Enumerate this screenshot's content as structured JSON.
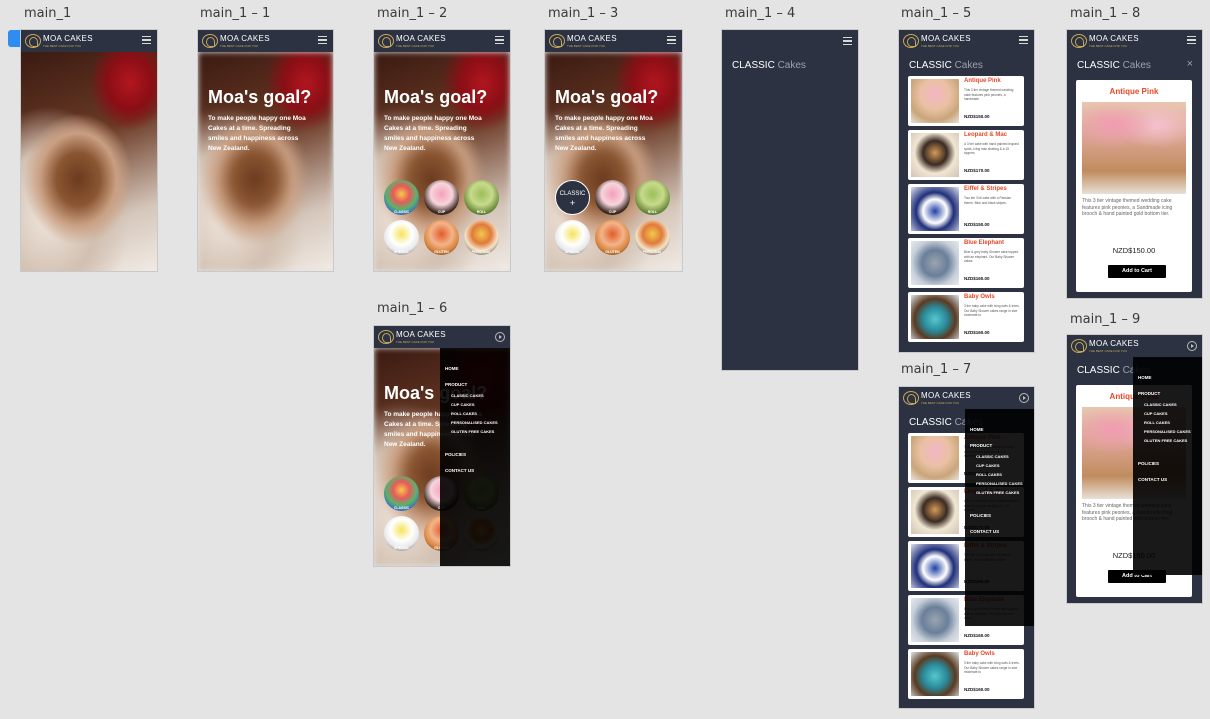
{
  "artboards": {
    "a1": "main_1",
    "a2": "main_1 – 1",
    "a3": "main_1 – 2",
    "a4": "main_1 – 3",
    "a5": "main_1 – 4",
    "a6": "main_1 – 5",
    "a7": "main_1 – 8",
    "a8": "main_1 – 6",
    "a9": "main_1 – 7",
    "a10": "main_1 – 9"
  },
  "brand": {
    "name": "MOA CAKES",
    "tagline": "THE BEST CAKE FOR YOU"
  },
  "hero": {
    "title": "Moa's goal?",
    "text": "To make people happy one Moa Cakes at a time. Spreading smiles and happiness across New Zealand."
  },
  "categories": {
    "c1": "CLASSIC",
    "c2": "CUP",
    "c3": "ROLL",
    "c4": "SPECIAL",
    "c5": "GLUTEN",
    "c6": "PERSONAL",
    "selected_label": "CLASSIC",
    "selected_icon": "+"
  },
  "classic": {
    "title_a": "CLASSIC",
    "title_b": "Cakes"
  },
  "products": [
    {
      "name": "Antique Pink",
      "desc": "This 3 tier vintage themed wedding cake features pink peonies, a handmade",
      "price": "NZD$150.00"
    },
    {
      "name": "Leopard & Mac",
      "desc": "A 3 tier cake with hand painted leopard spots, Icing mac shaking & a 15 toppers",
      "price": "NZD$170.00"
    },
    {
      "name": "Eiffel & Stripes",
      "desc": "Two tier 3'x6 cake with a Parisian theme. Blue and black stripes.",
      "price": "NZD$150.00"
    },
    {
      "name": "Blue Elephant",
      "desc": "Blue & grey baby Shower cake topped with an elephant. Our Baby Shower cakes.",
      "price": "NZD$160.00"
    },
    {
      "name": "Baby Owls",
      "desc": "3 tier baby cake with icing owls & trees. Our Baby Shower cakes range in size moderate to",
      "price": "NZD$160.00"
    }
  ],
  "detail": {
    "name": "Antique Pink",
    "desc": "This 3 tier vintage themed wedding cake features pink peonies, a Sandmade icing brooch & hand painted gold bottom tier.",
    "price": "NZD$150.00",
    "cta": "Add to Cart",
    "close": "×"
  },
  "menu": {
    "home": "HOME",
    "product": "PRODUCT",
    "classic": "CLASSIC CAKES",
    "cup": "CUP CAKES",
    "roll": "ROLL CAKES",
    "personal": "PERSONALISED CAKES",
    "gluten": "GLUTEN FREE CAKES",
    "policies": "POLICIES",
    "contact": "CONTACT US"
  },
  "colors": {
    "header": "#2c3242",
    "accent": "#e64828",
    "canvas": "#e4e4e4",
    "selection": "#2f8cf0"
  }
}
